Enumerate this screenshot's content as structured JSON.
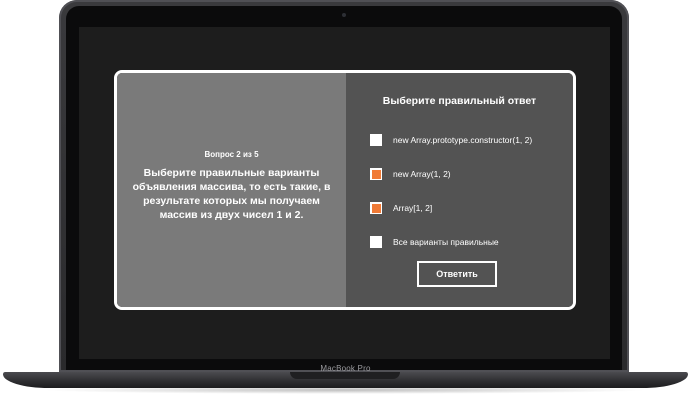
{
  "device": {
    "label": "MacBook Pro"
  },
  "quiz": {
    "counter": "Вопрос 2 из 5",
    "question": "Выберите правильные варианты объявления массива, то есть такие, в результате которых мы получаем массив из двух чисел 1 и 2.",
    "answers_title": "Выберите правильный ответ",
    "options": [
      {
        "label": "new Array.prototype.constructor(1, 2)",
        "checked": false
      },
      {
        "label": "new Array(1, 2)",
        "checked": true
      },
      {
        "label": "Array[1, 2]",
        "checked": true
      },
      {
        "label": "Все варианты правильные",
        "checked": false
      }
    ],
    "submit_label": "Ответить"
  },
  "colors": {
    "accent": "#f07a36",
    "left_pane": "#7a7a7a",
    "right_pane": "#535353",
    "screen_bg": "#1d1d1d"
  }
}
